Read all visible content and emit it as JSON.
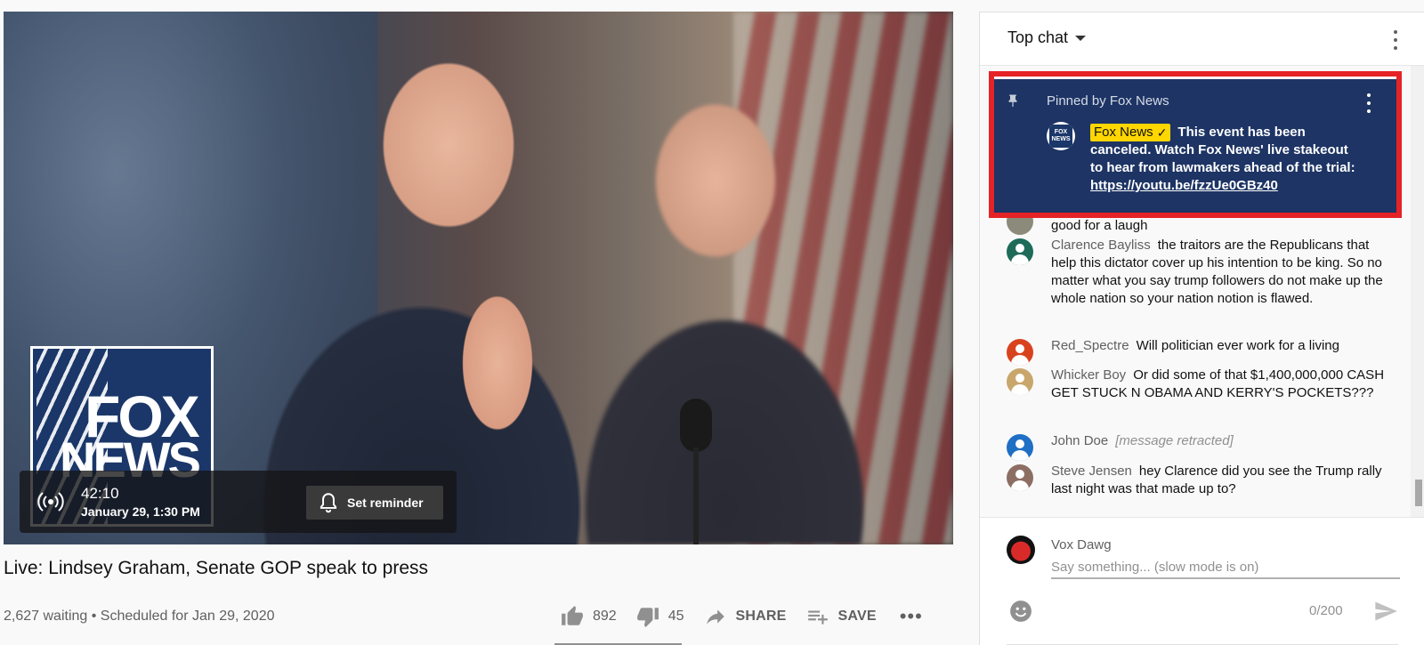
{
  "video": {
    "title": "Live: Lindsey Graham, Senate GOP speak to press",
    "meta": "2,627 waiting • Scheduled for Jan 29, 2020",
    "logo": {
      "line1": "FOX",
      "line2": "NEWS"
    },
    "overlay": {
      "countdown": "42:10",
      "date": "January 29, 1:30 PM",
      "reminder_label": "Set reminder"
    }
  },
  "actions": {
    "likes": "892",
    "dislikes": "45",
    "share_label": "SHARE",
    "save_label": "SAVE",
    "more": "•••"
  },
  "chat": {
    "header_title": "Top chat",
    "pinned": {
      "pinned_by": "Pinned by Fox News",
      "author": "Fox News",
      "avatar_text": "FOX NEWS",
      "message_text": "This event has been canceled. Watch Fox News' live stakeout to hear from lawmakers ahead of the trial: ",
      "link": "https://youtu.be/fzzUe0GBz40"
    },
    "partial_message": "good for a laugh",
    "messages": [
      {
        "author": "Clarence Bayliss",
        "text": "the traitors are the Republicans that help this dictator cover up his intention to be king. So no matter what you say trump followers do not make up the whole nation so your nation notion is flawed.",
        "avatar_color": "#1e6b5a"
      },
      {
        "author": "Red_Spectre",
        "text": "Will politician ever work for a living",
        "avatar_color": "#d8431e"
      },
      {
        "author": "Whicker Boy",
        "text": "Or did some of that $1,400,000,000 CASH GET STUCK N OBAMA AND KERRY'S POCKETS???",
        "avatar_color": "#c9a66b"
      },
      {
        "author": "John Doe",
        "text": "[message retracted]",
        "avatar_color": "#1f6fc4"
      },
      {
        "author": "Steve Jensen",
        "text": "hey Clarence did you see the Trump rally last night was that made up to?",
        "avatar_color": "#8d6e63"
      }
    ],
    "input": {
      "user": "Vox Dawg",
      "placeholder": "Say something... (slow mode is on)",
      "counter": "0/200"
    }
  }
}
